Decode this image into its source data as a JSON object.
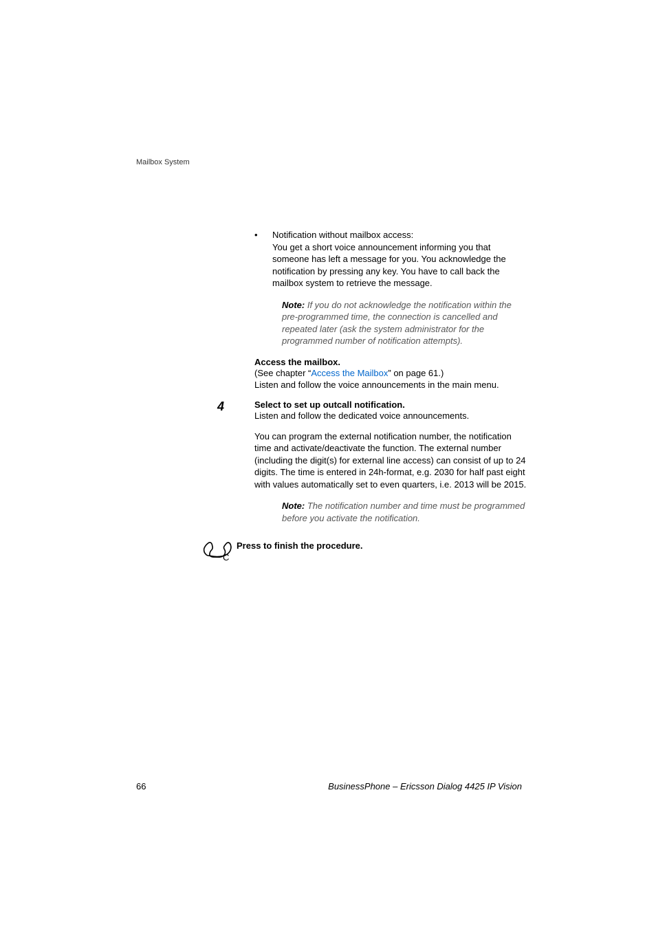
{
  "header": {
    "section_title": "Mailbox System"
  },
  "bullet": {
    "title": "Notification without mailbox access:",
    "body": "You get a short voice announcement informing you that someone has left a message for you. You acknowledge the notification by pressing any key. You have to call back the mailbox system to retrieve the message."
  },
  "note1": {
    "label": "Note:",
    "body": " If you do not acknowledge the notification within the pre-programmed time, the connection is cancelled and repeated later (ask the system administrator for the programmed number of notification attempts)."
  },
  "access": {
    "title": "Access the mailbox.",
    "prefix": "(See chapter “",
    "link": "Access the Mailbox",
    "suffix": "” on page 61.)",
    "line2": "Listen and follow the voice announcements in the main menu."
  },
  "step4": {
    "number": "4",
    "title": "Select to set up outcall notification.",
    "body": "Listen and follow the dedicated voice announcements."
  },
  "para": {
    "body": "You can program the external notification number, the notification time and activate/deactivate the function. The external number (including the digit(s) for external line access) can consist of up to 24 digits. The time is entered in 24h-format, e.g. 2030 for half past eight with values automatically set to even quarters, i.e. 2013 will be 2015."
  },
  "note2": {
    "label": "Note:",
    "body": " The notification number and time must be programmed before you activate the notification."
  },
  "finish": {
    "text": "Press to finish the procedure."
  },
  "footer": {
    "page_number": "66",
    "product": "BusinessPhone – Ericsson Dialog 4425 IP Vision"
  }
}
